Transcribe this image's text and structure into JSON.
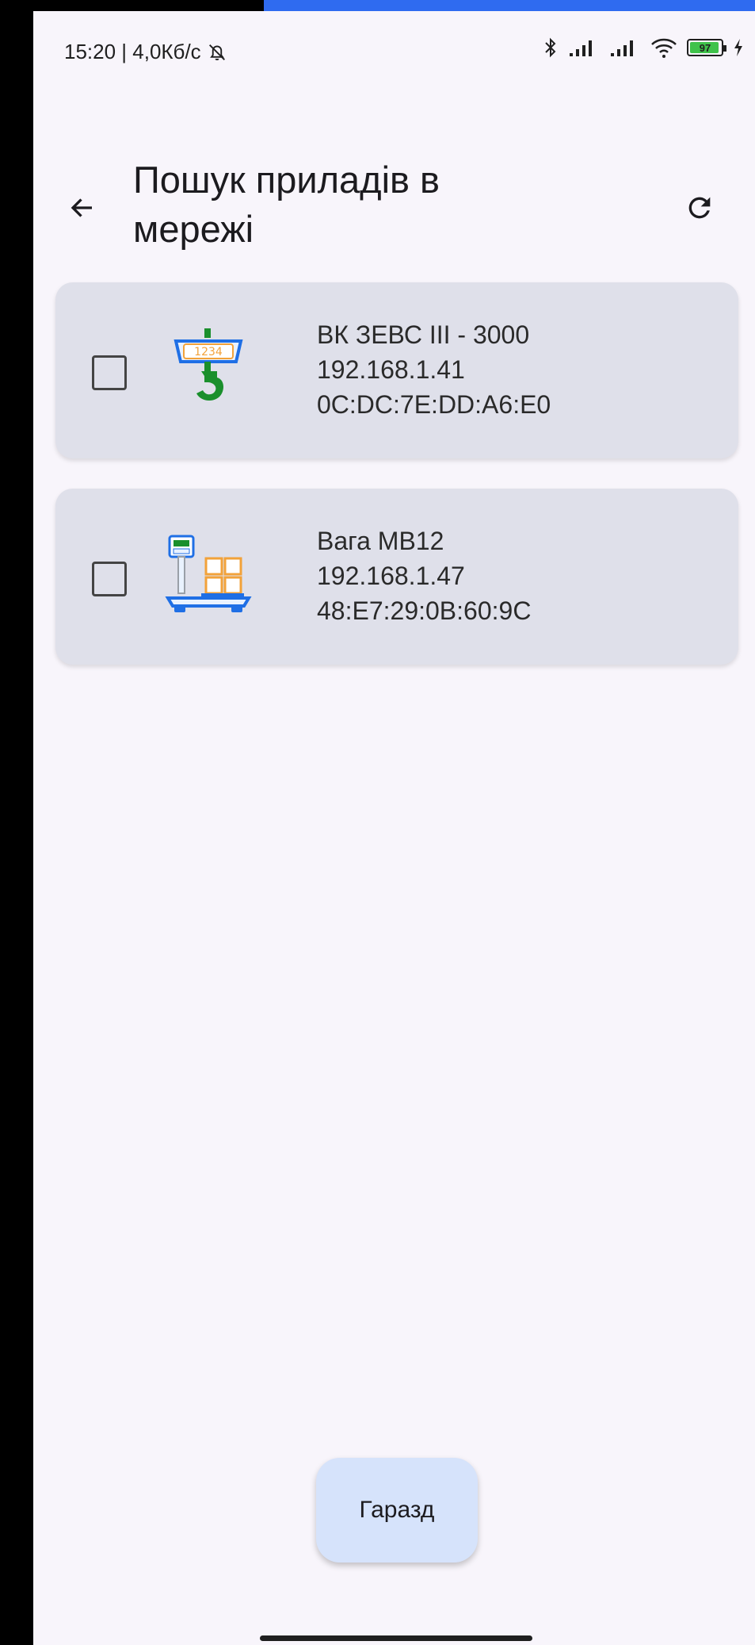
{
  "status_bar": {
    "time_speed": "15:20 | 4,0Кб/с",
    "battery_level": "97"
  },
  "app_bar": {
    "title": "Пошук приладів в мережі"
  },
  "devices": [
    {
      "name": "ВК ЗЕВС III - 3000",
      "ip": "192.168.1.41",
      "mac": "0C:DC:7E:DD:A6:E0",
      "icon": "crane-scale-icon",
      "icon_display": "1234",
      "checked": false
    },
    {
      "name": "Вага MB12",
      "ip": "192.168.1.47",
      "mac": "48:E7:29:0B:60:9C",
      "icon": "platform-scale-icon",
      "checked": false
    }
  ],
  "ok_button": {
    "label": "Гаразд"
  },
  "colors": {
    "background": "#f8f5fb",
    "card": "#dfe0ea",
    "button": "#d6e3fb",
    "accent": "#2f6bf0"
  }
}
